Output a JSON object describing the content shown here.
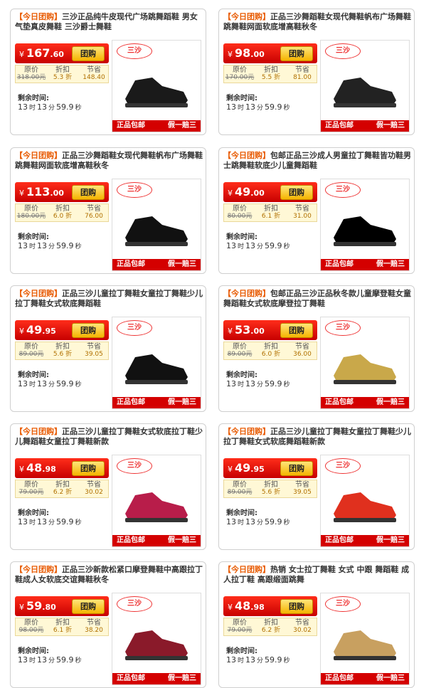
{
  "time_label": "剩余时间:",
  "cards": [
    {
      "tag": "【今日团购】",
      "title": "三沙正品纯牛皮现代广场跳舞蹈鞋 男女气垫真皮舞鞋 三沙爵士舞鞋",
      "currency": "¥",
      "price_int": "167",
      "price_dec": ".60",
      "buy": "团购",
      "orig_label": "原价",
      "orig": "318.00元",
      "disc_label": "折扣",
      "disc": "5.3 折",
      "save_label": "节省",
      "save": "148.40",
      "time": [
        "13",
        "时",
        "13",
        "分",
        "59.9",
        "秒"
      ],
      "brand": "三沙",
      "banner_left": "正品包邮",
      "banner_right": "假一赔三",
      "shoe_color": "#1a1a1a"
    },
    {
      "tag": "【今日团购】",
      "title": "正品三沙舞蹈鞋女现代舞鞋帆布广场舞鞋跳舞鞋网面软底增高鞋秋冬",
      "currency": "¥",
      "price_int": "98",
      "price_dec": ".00",
      "buy": "团购",
      "orig_label": "原价",
      "orig": "170.00元",
      "disc_label": "折扣",
      "disc": "5.5 折",
      "save_label": "节省",
      "save": "81.00",
      "time": [
        "13",
        "时",
        "13",
        "分",
        "59.9",
        "秒"
      ],
      "brand": "三沙",
      "banner_left": "正品包邮",
      "banner_right": "假一赔三",
      "shoe_color": "#222"
    },
    {
      "tag": "【今日团购】",
      "title": "正品三沙舞蹈鞋女现代舞鞋帆布广场舞鞋跳舞鞋网面软底增高鞋秋冬",
      "currency": "¥",
      "price_int": "113",
      "price_dec": ".00",
      "buy": "团购",
      "orig_label": "原价",
      "orig": "180.00元",
      "disc_label": "折扣",
      "disc": "6.0 折",
      "save_label": "节省",
      "save": "76.00",
      "time": [
        "13",
        "时",
        "13",
        "分",
        "59.9",
        "秒"
      ],
      "brand": "三沙",
      "banner_left": "正品包邮",
      "banner_right": "假一赔三",
      "shoe_color": "#111"
    },
    {
      "tag": "【今日团购】",
      "title": "包邮正品三沙成人男童拉丁舞鞋皆功鞋男士跳舞鞋软底少儿童舞蹈鞋",
      "currency": "¥",
      "price_int": "49",
      "price_dec": ".00",
      "buy": "团购",
      "orig_label": "原价",
      "orig": "80.00元",
      "disc_label": "折扣",
      "disc": "6.1 折",
      "save_label": "节省",
      "save": "31.00",
      "time": [
        "13",
        "时",
        "13",
        "分",
        "59.9",
        "秒"
      ],
      "brand": "三沙",
      "banner_left": "正品包邮",
      "banner_right": "假一赔三",
      "shoe_color": "#000"
    },
    {
      "tag": "【今日团购】",
      "title": "正品三沙儿童拉丁舞鞋女童拉丁舞鞋少儿拉丁舞鞋女式软底舞蹈鞋",
      "currency": "¥",
      "price_int": "49",
      "price_dec": ".95",
      "buy": "团购",
      "orig_label": "原价",
      "orig": "89.00元",
      "disc_label": "折扣",
      "disc": "5.6 折",
      "save_label": "节省",
      "save": "39.05",
      "time": [
        "13",
        "时",
        "13",
        "分",
        "59.9",
        "秒"
      ],
      "brand": "三沙",
      "banner_left": "正品包邮",
      "banner_right": "假一赔三",
      "shoe_color": "#111"
    },
    {
      "tag": "【今日团购】",
      "title": "包邮正品三沙正品秋冬款儿童摩登鞋女童舞蹈鞋女式软底摩登拉丁舞鞋",
      "currency": "¥",
      "price_int": "53",
      "price_dec": ".00",
      "buy": "团购",
      "orig_label": "原价",
      "orig": "89.00元",
      "disc_label": "折扣",
      "disc": "6.0 折",
      "save_label": "节省",
      "save": "36.00",
      "time": [
        "13",
        "时",
        "13",
        "分",
        "59.9",
        "秒"
      ],
      "brand": "三沙",
      "banner_left": "正品包邮",
      "banner_right": "假一赔三",
      "shoe_color": "#c9a84a"
    },
    {
      "tag": "【今日团购】",
      "title": "正品三沙儿童拉丁舞鞋女式软底拉丁鞋少儿舞蹈鞋女童拉丁舞鞋新款",
      "currency": "¥",
      "price_int": "48",
      "price_dec": ".98",
      "buy": "团购",
      "orig_label": "原价",
      "orig": "79.00元",
      "disc_label": "折扣",
      "disc": "6.2 折",
      "save_label": "节省",
      "save": "30.02",
      "time": [
        "13",
        "时",
        "13",
        "分",
        "59.9",
        "秒"
      ],
      "brand": "三沙",
      "banner_left": "正品包邮",
      "banner_right": "假一赔三",
      "shoe_color": "#b81d4a"
    },
    {
      "tag": "【今日团购】",
      "title": "正品三沙儿童拉丁舞鞋女童拉丁舞鞋少儿拉丁舞鞋女式软底舞蹈鞋新款",
      "currency": "¥",
      "price_int": "49",
      "price_dec": ".95",
      "buy": "团购",
      "orig_label": "原价",
      "orig": "89.00元",
      "disc_label": "折扣",
      "disc": "5.6 折",
      "save_label": "节省",
      "save": "39.05",
      "time": [
        "13",
        "时",
        "13",
        "分",
        "59.9",
        "秒"
      ],
      "brand": "三沙",
      "banner_left": "正品包邮",
      "banner_right": "假一赔三",
      "shoe_color": "#e0301e"
    },
    {
      "tag": "【今日团购】",
      "title": "正品三沙新款松紧口摩登舞鞋中高跟拉丁鞋成人女软底交谊舞鞋秋冬",
      "currency": "¥",
      "price_int": "59",
      "price_dec": ".80",
      "buy": "团购",
      "orig_label": "原价",
      "orig": "98.00元",
      "disc_label": "折扣",
      "disc": "6.1 折",
      "save_label": "节省",
      "save": "38.20",
      "time": [
        "13",
        "时",
        "13",
        "分",
        "59.9",
        "秒"
      ],
      "brand": "三沙",
      "banner_left": "正品包邮",
      "banner_right": "假一赔三",
      "shoe_color": "#8a1a2a"
    },
    {
      "tag": "【今日团购】",
      "title": "热销 女士拉丁舞鞋 女式 中跟 舞蹈鞋 成人拉丁鞋 高跟缎面跳舞",
      "currency": "¥",
      "price_int": "48",
      "price_dec": ".98",
      "buy": "团购",
      "orig_label": "原价",
      "orig": "79.00元",
      "disc_label": "折扣",
      "disc": "6.2 折",
      "save_label": "节省",
      "save": "30.02",
      "time": [
        "13",
        "时",
        "13",
        "分",
        "59.9",
        "秒"
      ],
      "brand": "三沙",
      "banner_left": "正品包邮",
      "banner_right": "假一赔三",
      "shoe_color": "#c8a060"
    }
  ]
}
